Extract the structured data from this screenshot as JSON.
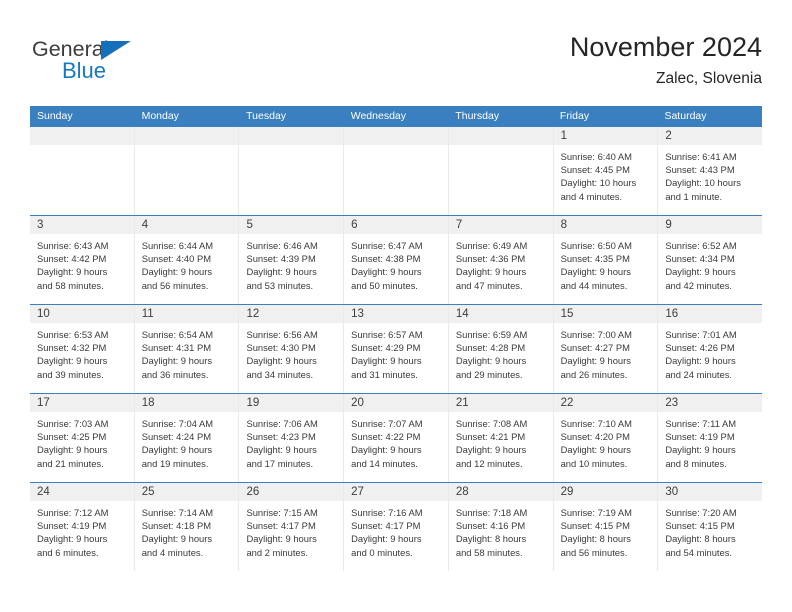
{
  "brand": {
    "name_top": "General",
    "name_bottom": "Blue",
    "triangle_color": "#1570bc",
    "text_color": "#3c3c3c",
    "blue_color": "#1679c4"
  },
  "header": {
    "title": "November 2024",
    "subtitle": "Zalec, Slovenia"
  },
  "theme": {
    "header_bg": "#3a80c1",
    "header_text": "#ffffff",
    "daynum_bg": "#f0f0f0",
    "row_rule": "#3a80c1",
    "body_text": "#3a3a3a"
  },
  "weekdays": [
    "Sunday",
    "Monday",
    "Tuesday",
    "Wednesday",
    "Thursday",
    "Friday",
    "Saturday"
  ],
  "weeks": [
    [
      {
        "day": "",
        "info": ""
      },
      {
        "day": "",
        "info": ""
      },
      {
        "day": "",
        "info": ""
      },
      {
        "day": "",
        "info": ""
      },
      {
        "day": "",
        "info": ""
      },
      {
        "day": "1",
        "info": "Sunrise: 6:40 AM\nSunset: 4:45 PM\nDaylight: 10 hours\nand 4 minutes."
      },
      {
        "day": "2",
        "info": "Sunrise: 6:41 AM\nSunset: 4:43 PM\nDaylight: 10 hours\nand 1 minute."
      }
    ],
    [
      {
        "day": "3",
        "info": "Sunrise: 6:43 AM\nSunset: 4:42 PM\nDaylight: 9 hours\nand 58 minutes."
      },
      {
        "day": "4",
        "info": "Sunrise: 6:44 AM\nSunset: 4:40 PM\nDaylight: 9 hours\nand 56 minutes."
      },
      {
        "day": "5",
        "info": "Sunrise: 6:46 AM\nSunset: 4:39 PM\nDaylight: 9 hours\nand 53 minutes."
      },
      {
        "day": "6",
        "info": "Sunrise: 6:47 AM\nSunset: 4:38 PM\nDaylight: 9 hours\nand 50 minutes."
      },
      {
        "day": "7",
        "info": "Sunrise: 6:49 AM\nSunset: 4:36 PM\nDaylight: 9 hours\nand 47 minutes."
      },
      {
        "day": "8",
        "info": "Sunrise: 6:50 AM\nSunset: 4:35 PM\nDaylight: 9 hours\nand 44 minutes."
      },
      {
        "day": "9",
        "info": "Sunrise: 6:52 AM\nSunset: 4:34 PM\nDaylight: 9 hours\nand 42 minutes."
      }
    ],
    [
      {
        "day": "10",
        "info": "Sunrise: 6:53 AM\nSunset: 4:32 PM\nDaylight: 9 hours\nand 39 minutes."
      },
      {
        "day": "11",
        "info": "Sunrise: 6:54 AM\nSunset: 4:31 PM\nDaylight: 9 hours\nand 36 minutes."
      },
      {
        "day": "12",
        "info": "Sunrise: 6:56 AM\nSunset: 4:30 PM\nDaylight: 9 hours\nand 34 minutes."
      },
      {
        "day": "13",
        "info": "Sunrise: 6:57 AM\nSunset: 4:29 PM\nDaylight: 9 hours\nand 31 minutes."
      },
      {
        "day": "14",
        "info": "Sunrise: 6:59 AM\nSunset: 4:28 PM\nDaylight: 9 hours\nand 29 minutes."
      },
      {
        "day": "15",
        "info": "Sunrise: 7:00 AM\nSunset: 4:27 PM\nDaylight: 9 hours\nand 26 minutes."
      },
      {
        "day": "16",
        "info": "Sunrise: 7:01 AM\nSunset: 4:26 PM\nDaylight: 9 hours\nand 24 minutes."
      }
    ],
    [
      {
        "day": "17",
        "info": "Sunrise: 7:03 AM\nSunset: 4:25 PM\nDaylight: 9 hours\nand 21 minutes."
      },
      {
        "day": "18",
        "info": "Sunrise: 7:04 AM\nSunset: 4:24 PM\nDaylight: 9 hours\nand 19 minutes."
      },
      {
        "day": "19",
        "info": "Sunrise: 7:06 AM\nSunset: 4:23 PM\nDaylight: 9 hours\nand 17 minutes."
      },
      {
        "day": "20",
        "info": "Sunrise: 7:07 AM\nSunset: 4:22 PM\nDaylight: 9 hours\nand 14 minutes."
      },
      {
        "day": "21",
        "info": "Sunrise: 7:08 AM\nSunset: 4:21 PM\nDaylight: 9 hours\nand 12 minutes."
      },
      {
        "day": "22",
        "info": "Sunrise: 7:10 AM\nSunset: 4:20 PM\nDaylight: 9 hours\nand 10 minutes."
      },
      {
        "day": "23",
        "info": "Sunrise: 7:11 AM\nSunset: 4:19 PM\nDaylight: 9 hours\nand 8 minutes."
      }
    ],
    [
      {
        "day": "24",
        "info": "Sunrise: 7:12 AM\nSunset: 4:19 PM\nDaylight: 9 hours\nand 6 minutes."
      },
      {
        "day": "25",
        "info": "Sunrise: 7:14 AM\nSunset: 4:18 PM\nDaylight: 9 hours\nand 4 minutes."
      },
      {
        "day": "26",
        "info": "Sunrise: 7:15 AM\nSunset: 4:17 PM\nDaylight: 9 hours\nand 2 minutes."
      },
      {
        "day": "27",
        "info": "Sunrise: 7:16 AM\nSunset: 4:17 PM\nDaylight: 9 hours\nand 0 minutes."
      },
      {
        "day": "28",
        "info": "Sunrise: 7:18 AM\nSunset: 4:16 PM\nDaylight: 8 hours\nand 58 minutes."
      },
      {
        "day": "29",
        "info": "Sunrise: 7:19 AM\nSunset: 4:15 PM\nDaylight: 8 hours\nand 56 minutes."
      },
      {
        "day": "30",
        "info": "Sunrise: 7:20 AM\nSunset: 4:15 PM\nDaylight: 8 hours\nand 54 minutes."
      }
    ]
  ]
}
